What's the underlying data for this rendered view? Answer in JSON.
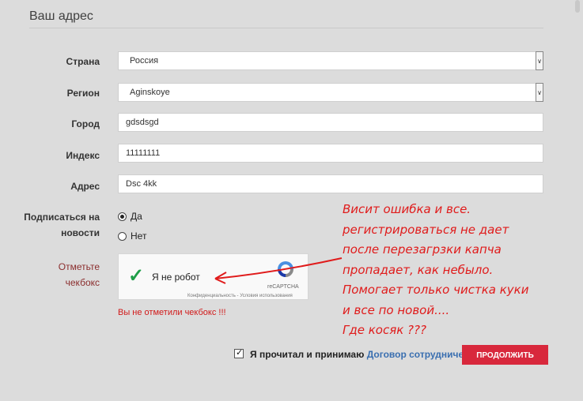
{
  "section": {
    "title": "Ваш адрес"
  },
  "fields": {
    "country": {
      "label": "Страна",
      "value": "Россия"
    },
    "region": {
      "label": "Регион",
      "value": "Aginskoye"
    },
    "city": {
      "label": "Город",
      "value": "gdsdsgd"
    },
    "index": {
      "label": "Индекс",
      "value": "11111111"
    },
    "address": {
      "label": "Адрес",
      "value": "Dsc 4kk"
    }
  },
  "newsletter": {
    "label_line1": "Подписаться на",
    "label_line2": "новости",
    "options": [
      {
        "label": "Да",
        "selected": true
      },
      {
        "label": "Нет",
        "selected": false
      }
    ]
  },
  "captcha": {
    "label_line1": "Отметьте",
    "label_line2": "чекбокс",
    "checkbox_label": "Я не робот",
    "brand": "reCAPTCHA",
    "links": "Конфиденциальность - Условия использования",
    "checked_icon": "check-icon",
    "error": "Вы не отметили чекбокс !!!"
  },
  "annotation": {
    "lines": [
      "Висит ошибка и все.",
      "регистрироваться не дает",
      "после перезагрзки капча",
      "пропадает, как небыло.",
      "Помогает только чистка куки",
      "и все по новой....",
      "Где косяк ???"
    ],
    "color": "#e01b1b"
  },
  "agreement": {
    "text": "Я прочитал и принимаю",
    "link": "Договор сотрудничества",
    "checked": true
  },
  "submit": {
    "label": "ПРОДОЛЖИТЬ",
    "color": "#d8283c"
  }
}
